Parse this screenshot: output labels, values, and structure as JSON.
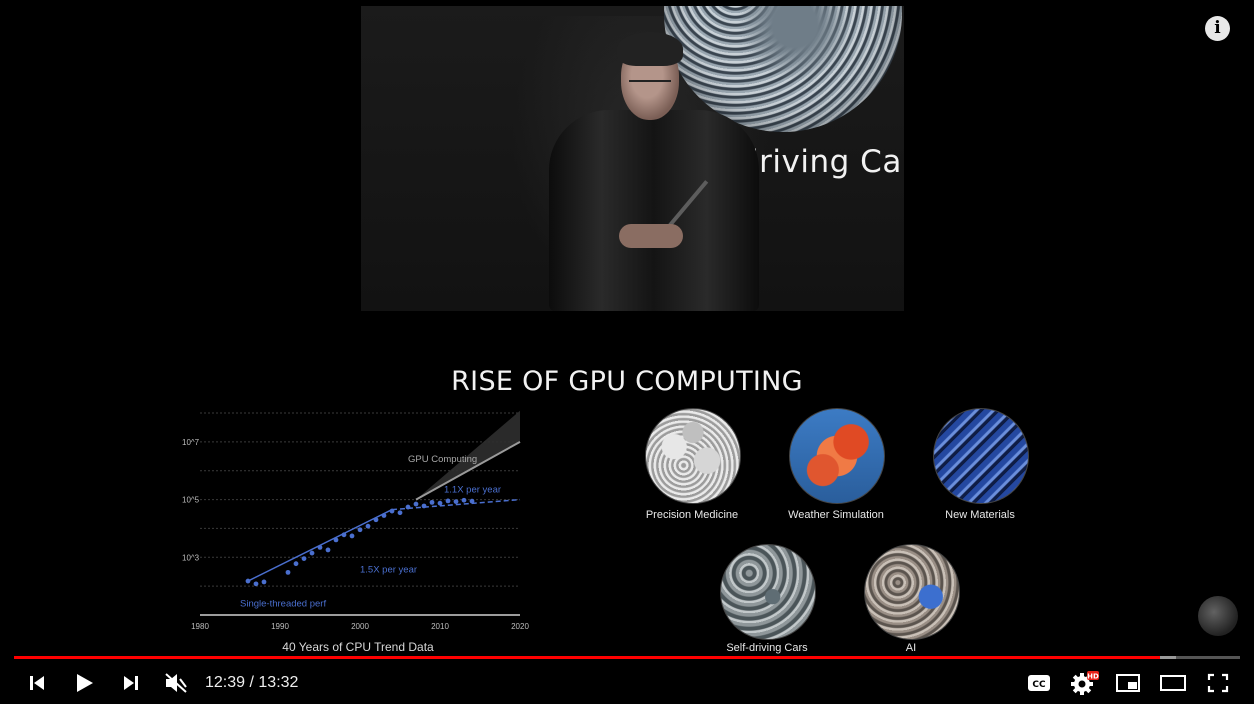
{
  "video": {
    "camera_slide_text": "driving Cars",
    "slide_title": "RISE OF GPU COMPUTING",
    "cpu_chart_caption": "40 Years of CPU Trend Data"
  },
  "chart_data": {
    "type": "scatter",
    "title": "",
    "x_ticks": [
      "1980",
      "1990",
      "2000",
      "2010",
      "2020"
    ],
    "y_ticks": [
      "10^3",
      "10^5",
      "10^7"
    ],
    "xlim": [
      1980,
      2020
    ],
    "y_scale": "log",
    "ylim": [
      10,
      100000000
    ],
    "grid": true,
    "annotations": [
      "GPU Computing",
      "1.1X per year",
      "1.5X per year",
      "Single-threaded perf"
    ],
    "series": [
      {
        "name": "Single-threaded perf",
        "color": "#4a6fcf",
        "points": [
          [
            1986,
            150
          ],
          [
            1987,
            120
          ],
          [
            1988,
            140
          ],
          [
            1991,
            300
          ],
          [
            1992,
            600
          ],
          [
            1993,
            900
          ],
          [
            1994,
            1400
          ],
          [
            1995,
            2200
          ],
          [
            1996,
            1800
          ],
          [
            1997,
            4000
          ],
          [
            1998,
            6000
          ],
          [
            1999,
            5500
          ],
          [
            2000,
            9000
          ],
          [
            2001,
            12000
          ],
          [
            2002,
            20000
          ],
          [
            2003,
            28000
          ],
          [
            2004,
            40000
          ],
          [
            2005,
            35000
          ],
          [
            2006,
            55000
          ],
          [
            2007,
            70000
          ],
          [
            2008,
            60000
          ],
          [
            2009,
            80000
          ],
          [
            2010,
            75000
          ],
          [
            2011,
            90000
          ],
          [
            2012,
            85000
          ],
          [
            2013,
            95000
          ],
          [
            2014,
            88000
          ]
        ],
        "trend_1_5x": [
          [
            1986,
            150
          ],
          [
            2004,
            45000
          ]
        ],
        "trend_1_1x": [
          [
            2004,
            45000
          ],
          [
            2020,
            100000
          ]
        ]
      },
      {
        "name": "GPU Computing",
        "color": "#9a9a9a",
        "trend": [
          [
            2007,
            100000
          ],
          [
            2020,
            10000000
          ]
        ]
      }
    ]
  },
  "applications": [
    {
      "label": "Precision Medicine"
    },
    {
      "label": "Weather Simulation"
    },
    {
      "label": "New Materials"
    },
    {
      "label": "Self-driving Cars"
    },
    {
      "label": "AI"
    }
  ],
  "player": {
    "current_time": "12:39",
    "separator": " / ",
    "duration": "13:32",
    "progress_fraction": 0.935,
    "buffer_fraction": 0.948,
    "played_color": "#ff0000",
    "hd_badge": "HD",
    "icons": [
      "previous-icon",
      "play-icon",
      "next-icon",
      "volume-muted-icon",
      "captions-icon",
      "settings-icon",
      "miniplayer-icon",
      "theater-mode-icon",
      "fullscreen-icon",
      "info-icon"
    ]
  }
}
